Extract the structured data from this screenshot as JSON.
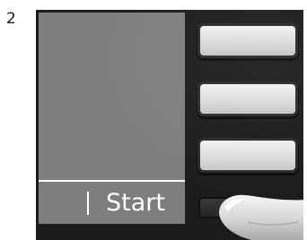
{
  "step": {
    "number": "2"
  },
  "screen": {
    "softkey_label": "Start"
  },
  "buttons": [
    {
      "name": "line-button-1"
    },
    {
      "name": "line-button-2"
    },
    {
      "name": "line-button-3"
    },
    {
      "name": "start-softkey-button"
    }
  ],
  "colors": {
    "screen": "#7e7e7e",
    "device": "#1c1c1c",
    "button": "#e4e4e4"
  },
  "icons": {
    "finger": "finger-pressing-icon"
  }
}
